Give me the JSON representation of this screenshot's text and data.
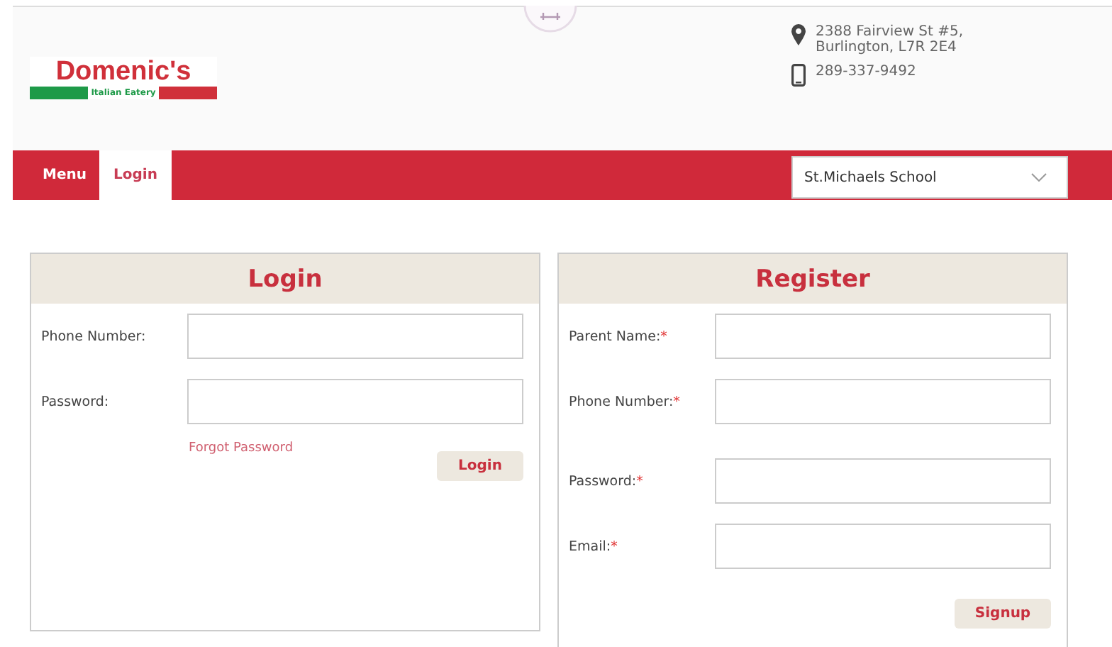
{
  "logo": {
    "name": "Domenic's",
    "tagline": "Italian Eatery"
  },
  "contact": {
    "address_lines": [
      "2388 Fairview St #5,",
      "Burlington, L7R 2E4"
    ],
    "phone": "289-337-9492"
  },
  "nav": {
    "tabs": [
      {
        "label": "Menu",
        "selected": false
      },
      {
        "label": "Login",
        "selected": true
      }
    ],
    "school_select": {
      "value": "St.Michaels School"
    }
  },
  "login": {
    "title": "Login",
    "fields": [
      {
        "label": "Phone Number:"
      },
      {
        "label": "Password:"
      }
    ],
    "forgot_link": "Forgot Password",
    "button": "Login"
  },
  "register": {
    "title": "Register",
    "fields": [
      {
        "label": "Parent Name:",
        "mark": "*"
      },
      {
        "label": "Phone Number:",
        "mark": "*"
      },
      {
        "label": "Password:",
        "mark": "*"
      },
      {
        "label": "Email:",
        "mark": "*"
      }
    ],
    "button": "Signup"
  }
}
